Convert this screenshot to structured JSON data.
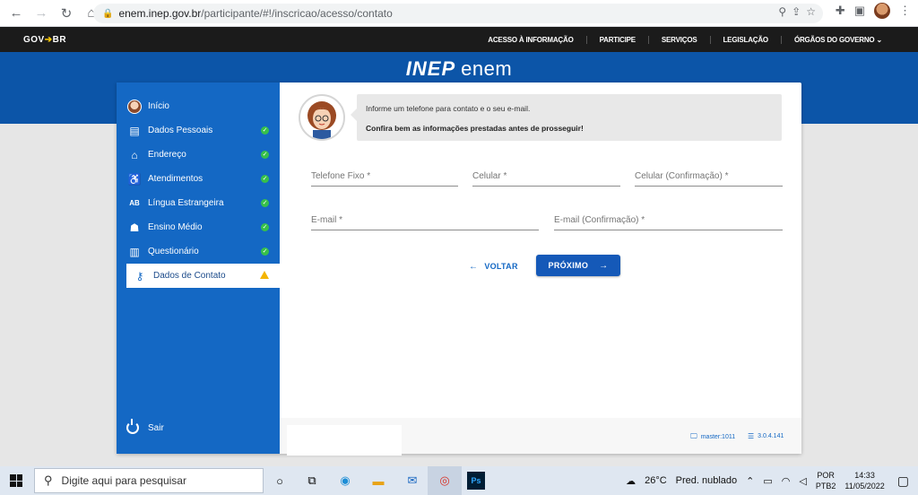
{
  "browser": {
    "url_host": "enem.inep.gov.br",
    "url_path": "/participante/#!/inscricao/acesso/contato"
  },
  "gov_bar": {
    "logo": "GOV",
    "logo_suffix": "BR",
    "links": [
      "ACESSO À INFORMAÇÃO",
      "PARTICIPE",
      "SERVIÇOS",
      "LEGISLAÇÃO",
      "ÓRGÃOS DO GOVERNO"
    ]
  },
  "brand": {
    "part1": "INEP",
    "part2": "enem"
  },
  "sidebar": {
    "items": [
      {
        "label": "Início",
        "icon": "user-avatar-icon",
        "status": "none"
      },
      {
        "label": "Dados Pessoais",
        "icon": "id-card-icon",
        "status": "done"
      },
      {
        "label": "Endereço",
        "icon": "home-icon",
        "status": "done"
      },
      {
        "label": "Atendimentos",
        "icon": "accessibility-icon",
        "status": "done"
      },
      {
        "label": "Língua Estrangeira",
        "icon": "language-icon",
        "status": "done"
      },
      {
        "label": "Ensino Médio",
        "icon": "graduate-icon",
        "status": "done"
      },
      {
        "label": "Questionário",
        "icon": "clipboard-icon",
        "status": "done"
      },
      {
        "label": "Dados de Contato",
        "icon": "key-icon",
        "status": "warning",
        "active": true
      }
    ],
    "logout_label": "Sair"
  },
  "message": {
    "line1": "Informe um telefone para contato e o seu e-mail.",
    "line2": "Confira bem as informações prestadas antes de prosseguir!"
  },
  "form": {
    "telefone_fixo": "Telefone Fixo *",
    "celular": "Celular *",
    "celular_confirmacao": "Celular (Confirmação) *",
    "email": "E-mail *",
    "email_confirmacao": "E-mail (Confirmação) *"
  },
  "actions": {
    "back_label": "VOLTAR",
    "next_label": "PRÓXIMO"
  },
  "footer": {
    "server": "master:1011",
    "version": "3.0.4.141"
  },
  "taskbar": {
    "search_placeholder": "Digite aqui para pesquisar",
    "weather_temp": "26°C",
    "weather_desc": "Pred. nublado",
    "lang_line1": "POR",
    "lang_line2": "PTB2",
    "time": "14:33",
    "date": "11/05/2022"
  },
  "colors": {
    "primary": "#1468c4",
    "header": "#0c55a8",
    "success": "#37c04a",
    "warning": "#f4b400"
  }
}
